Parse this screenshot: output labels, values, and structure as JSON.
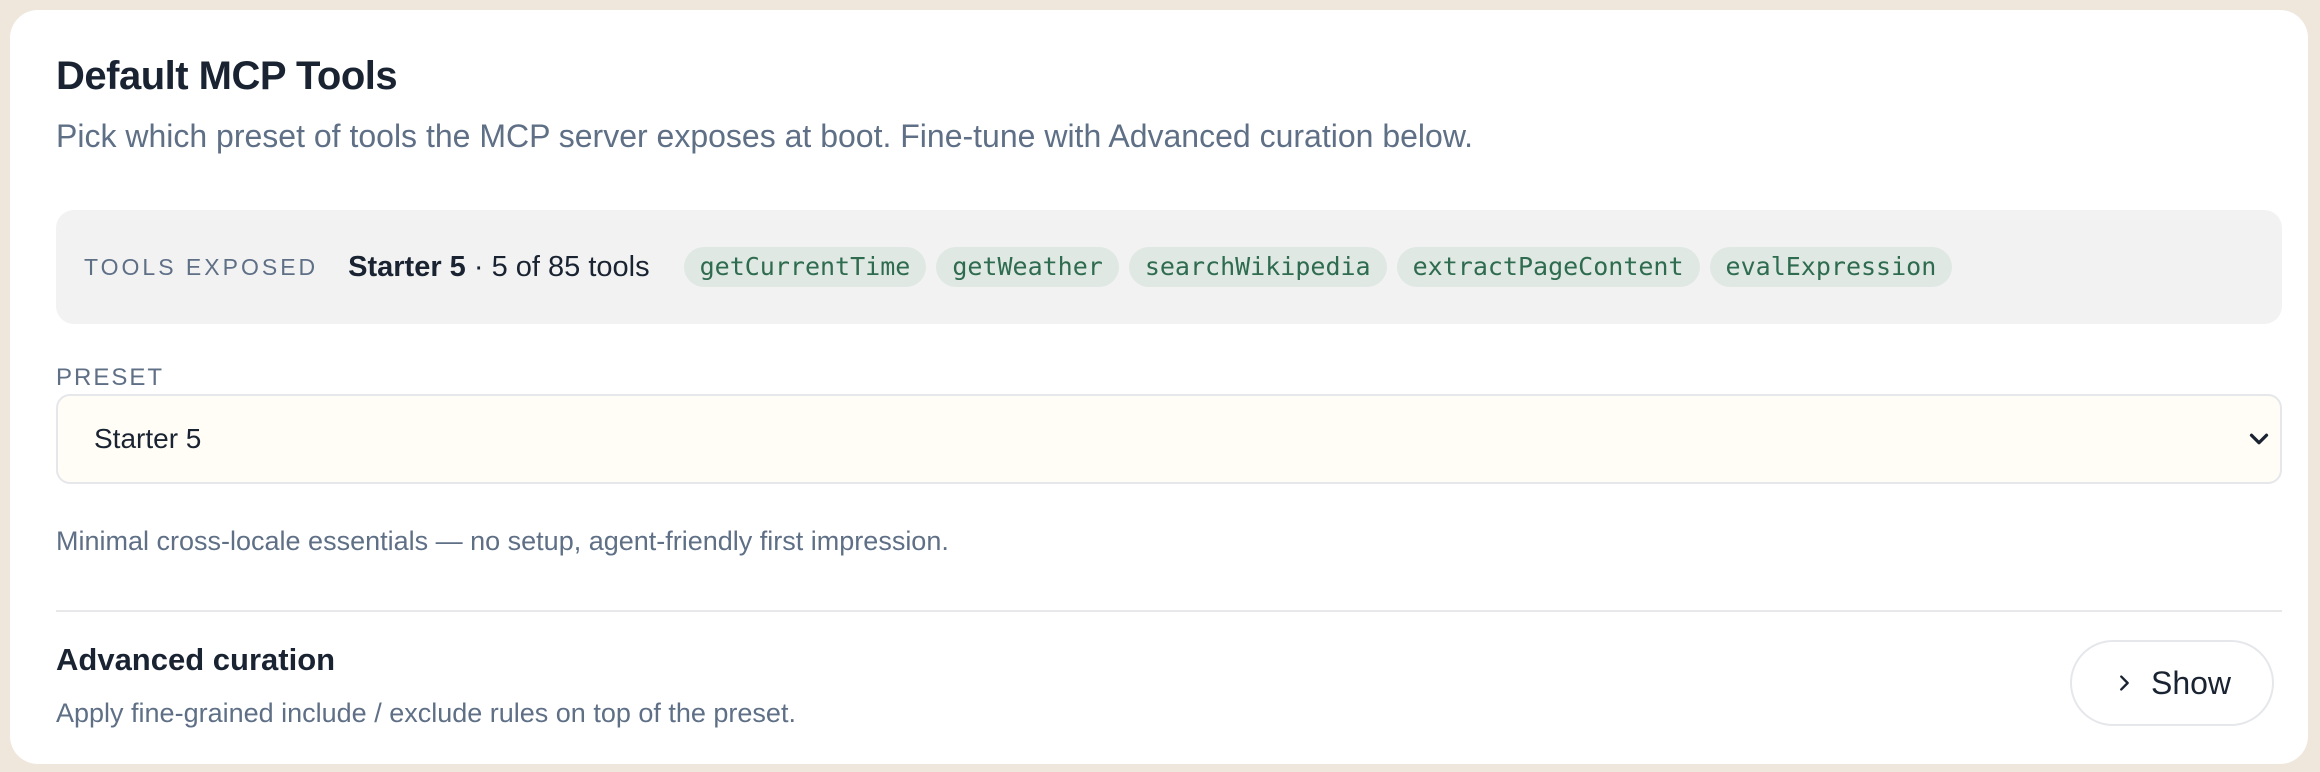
{
  "header": {
    "title": "Default MCP Tools",
    "subtitle": "Pick which preset of tools the MCP server exposes at boot. Fine-tune with Advanced curation below."
  },
  "exposed": {
    "label": "TOOLS EXPOSED",
    "preset_name": "Starter 5",
    "count_text": "· 5 of 85 tools",
    "tools": [
      "getCurrentTime",
      "getWeather",
      "searchWikipedia",
      "extractPageContent",
      "evalExpression"
    ]
  },
  "preset": {
    "label": "PRESET",
    "selected": "Starter 5",
    "description": "Minimal cross-locale essentials — no setup, agent-friendly first impression."
  },
  "advanced": {
    "title": "Advanced curation",
    "description": "Apply fine-grained include / exclude rules on top of the preset.",
    "button_label": "Show"
  },
  "colors": {
    "background": "#efe7dc",
    "card": "#ffffff",
    "heading": "#1a2332",
    "muted": "#5e6f86",
    "chip_bg": "#dfe8e3",
    "chip_text": "#2e6b4f",
    "select_bg": "#fffdf6"
  },
  "icons": {
    "select_chevron": "chevron-down-icon",
    "show_chevron": "chevron-right-icon"
  }
}
